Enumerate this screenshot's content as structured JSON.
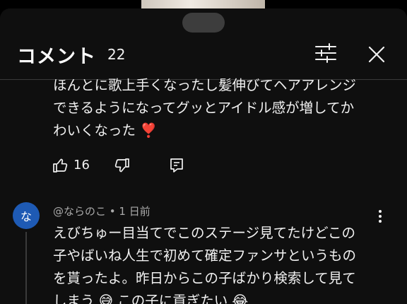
{
  "header": {
    "title": "コメント",
    "count": "22"
  },
  "comments": [
    {
      "text": "ほんとに歌上手くなったし髪伸びてヘアアレンジ\nできるようになってグッとアイドル感が増してか\nわいくなった ❣️",
      "likes": "16"
    },
    {
      "avatar_letter": "な",
      "author": "@ならのこ",
      "time": "1 日前",
      "text": "えびちゅー目当てでこのステージ見てたけどこの\n子やばいね人生で初めて確定ファンサというもの\nを貰ったよ。昨日からこの子ばかり検索して見て\nしまう 😅 この子に貢ぎたい 😂"
    }
  ],
  "icons": {
    "filter": "sliders-icon",
    "close": "close-icon",
    "like": "thumbs-up-icon",
    "dislike": "thumbs-down-icon",
    "reply": "reply-icon",
    "more": "more-vertical-icon"
  },
  "colors": {
    "background": "#0f0f0f",
    "avatar": "#1e5ab4",
    "secondary_text": "#aaaaaa"
  }
}
